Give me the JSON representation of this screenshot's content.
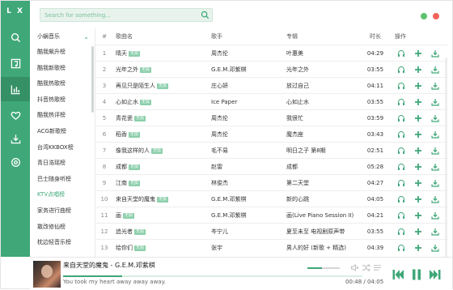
{
  "app": {
    "logo": "L X"
  },
  "colors": {
    "accent": "#3fa778",
    "accent_dark": "#359066",
    "badge": "#8ccfab",
    "dot_green": "#5cc26e",
    "dot_red": "#f0625a"
  },
  "rail": {
    "items": [
      {
        "icon": "search-icon",
        "active": false
      },
      {
        "icon": "song-list-icon",
        "active": false
      },
      {
        "icon": "chart-icon",
        "active": true
      },
      {
        "icon": "heart-icon",
        "active": false
      },
      {
        "icon": "download-icon",
        "active": false
      },
      {
        "icon": "settings-icon",
        "active": false
      }
    ]
  },
  "search": {
    "placeholder": "Search for something..."
  },
  "sidebar": {
    "source": "小蜗音乐",
    "items": [
      "酷我飙升榜",
      "酷我新歌榜",
      "酷我热歌榜",
      "抖音热歌榜",
      "酷我热评榜",
      "ACG新歌榜",
      "台湾KKBOX榜",
      "青日浩瑶榜",
      "巴士随身听榜",
      "KTV点唱榜",
      "家务进行曲榜",
      "敢改修仙榜",
      "枕边轻音乐榜"
    ],
    "active_index": 9
  },
  "table": {
    "headers": {
      "idx": "#",
      "name": "歌曲名",
      "singer": "歌手",
      "album": "专辑",
      "time": "时长",
      "ops": "操作"
    },
    "rows": [
      {
        "idx": "1",
        "name": "晴天",
        "badge": "无损",
        "singer": "周杰伦",
        "album": "叶惠美",
        "time": "04:29"
      },
      {
        "idx": "2",
        "name": "光年之外",
        "badge": "无损",
        "singer": "G.E.M.邓紫棋",
        "album": "光年之外",
        "time": "03:55"
      },
      {
        "idx": "3",
        "name": "再见只是陌生人",
        "badge": "无损",
        "singer": "庄心妍",
        "album": "放过自己",
        "time": "04:11"
      },
      {
        "idx": "4",
        "name": "心如止水",
        "badge": "无损",
        "singer": "Ice Paper",
        "album": "心如止水",
        "time": "03:55"
      },
      {
        "idx": "5",
        "name": "青花瓷",
        "badge": "无损",
        "singer": "周杰伦",
        "album": "我很忙",
        "time": "03:59"
      },
      {
        "idx": "6",
        "name": "稻香",
        "badge": "无损",
        "singer": "周杰伦",
        "album": "魔杰座",
        "time": "03:43"
      },
      {
        "idx": "7",
        "name": "像我这样的人",
        "badge": "无损",
        "singer": "毛不易",
        "album": "明日之子 第8期",
        "time": "02:51"
      },
      {
        "idx": "8",
        "name": "成都",
        "badge": "无损",
        "singer": "赵雷",
        "album": "成都",
        "time": "05:28"
      },
      {
        "idx": "9",
        "name": "江南",
        "badge": "无损",
        "singer": "林俊杰",
        "album": "第二天堂",
        "time": "04:27"
      },
      {
        "idx": "10",
        "name": "来自天堂的魔鬼",
        "badge": "无损",
        "singer": "G.E.M.邓紫棋",
        "album": "新的心跳",
        "time": "04:05"
      },
      {
        "idx": "11",
        "name": "画",
        "badge": "无损",
        "singer": "G.E.M.邓紫棋",
        "album": "画(Live Piano Session II)",
        "time": "04:21"
      },
      {
        "idx": "12",
        "name": "追光者",
        "badge": "无损",
        "singer": "岑宁儿",
        "album": "夏至未至 电视剧原声带",
        "time": "03:55"
      },
      {
        "idx": "13",
        "name": "给你们",
        "badge": "无损",
        "singer": "张宇",
        "album": "男人的好 (新歌 + 精选)",
        "time": "04:39"
      }
    ]
  },
  "player": {
    "title": "来自天堂的魔鬼 - G.E.M.邓紫棋",
    "lyric": "You took my heart away away away.",
    "time": "00:48 / 04:05",
    "progress": 0.196,
    "volume": 0.45
  }
}
